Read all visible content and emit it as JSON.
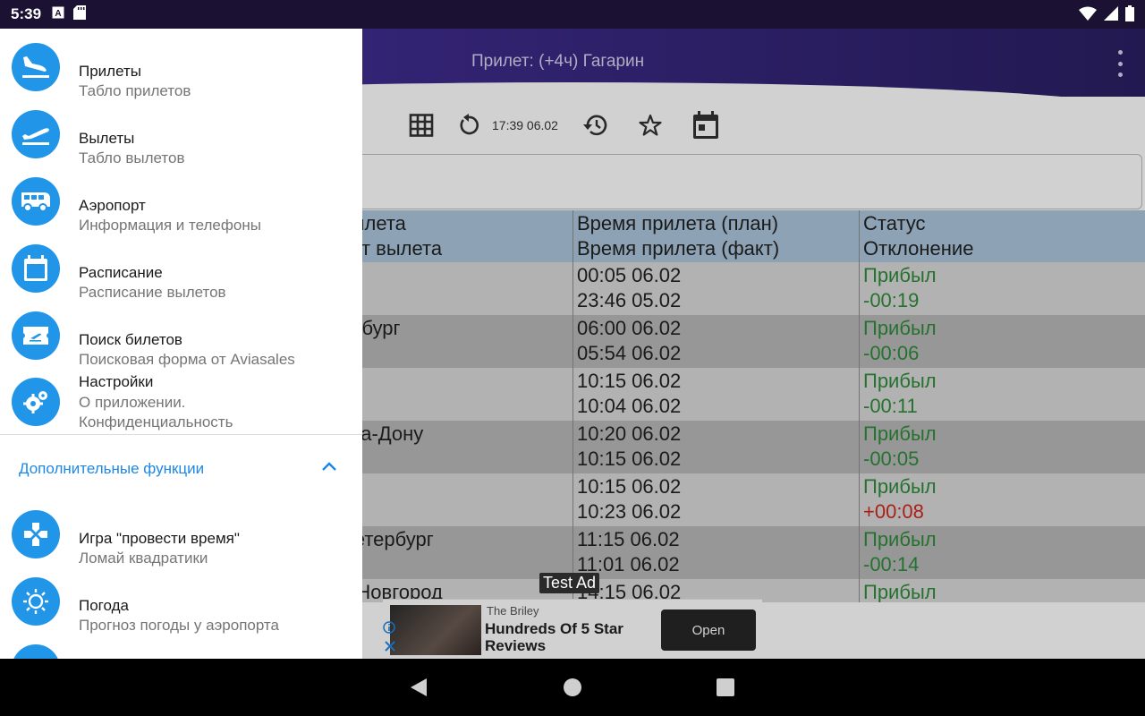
{
  "status_bar": {
    "time": "5:39",
    "icons": [
      "a-box-icon",
      "sd-card-icon",
      "wifi-icon",
      "signal-icon",
      "battery-icon"
    ]
  },
  "app_bar": {
    "title": "Прилет: (+4ч) Гагарин",
    "overflow_icon": "more-vert-icon"
  },
  "toolbar": {
    "update_time": "17:39 06.02",
    "icons": [
      "grid-icon",
      "refresh-icon",
      "history-icon",
      "star-icon",
      "calendar-icon"
    ]
  },
  "table": {
    "headers": {
      "col1_line1": "вылета",
      "col1_line2": "орт вылета",
      "col2_line1": "Время прилета (план)",
      "col2_line2": "Время прилета (факт)",
      "col3_line1": "Статус",
      "col3_line2": "Отклонение"
    },
    "rows": [
      {
        "city": "а",
        "planned": "00:05 06.02",
        "actual": "23:46 05.02",
        "status": "Прибыл",
        "deviation": "-00:19"
      },
      {
        "city": "инбург",
        "planned": "06:00 06.02",
        "actual": "05:54 06.02",
        "status": "Прибыл",
        "deviation": "-00:06"
      },
      {
        "city": "а",
        "planned": "10:15 06.02",
        "actual": "10:04 06.02",
        "status": "Прибыл",
        "deviation": "-00:11"
      },
      {
        "city": "-На-Дону",
        "planned": "10:20 06.02",
        "actual": "10:15 06.02",
        "status": "Прибыл",
        "deviation": "-00:05"
      },
      {
        "city": "а",
        "planned": "10:15 06.02",
        "actual": "10:23 06.02",
        "status": "Прибыл",
        "deviation": "+00:08"
      },
      {
        "city": "Петербург",
        "planned": "11:15 06.02",
        "actual": "11:01 06.02",
        "status": "Прибыл",
        "deviation": "-00:14"
      },
      {
        "city": "й Новгород",
        "planned": "14:15 06.02",
        "actual": "",
        "status": "Прибыл",
        "deviation": ""
      }
    ]
  },
  "ad": {
    "label": "Test Ad",
    "brand": "The Briley",
    "headline": "Hundreds Of 5 Star Reviews",
    "button": "Open"
  },
  "drawer": {
    "items": [
      {
        "title": "Прилеты",
        "subtitle": "Табло прилетов",
        "icon": "flight-land-icon"
      },
      {
        "title": "Вылеты",
        "subtitle": "Табло вылетов",
        "icon": "flight-takeoff-icon"
      },
      {
        "title": "Аэропорт",
        "subtitle": "Информация и телефоны",
        "icon": "bus-icon"
      },
      {
        "title": "Расписание",
        "subtitle": "Расписание вылетов",
        "icon": "calendar-icon"
      },
      {
        "title": "Поиск билетов",
        "subtitle": "Поисковая форма от Aviasales",
        "icon": "ticket-icon"
      },
      {
        "title": "Настройки",
        "subtitle_line1": "О приложении.",
        "subtitle_line2": "Конфиденциальность",
        "icon": "settings-icon"
      }
    ],
    "section_title": "Дополнительные функции",
    "extra_items": [
      {
        "title": "Игра \"провести время\"",
        "subtitle": "Ломай квадратики",
        "icon": "gamepad-icon"
      },
      {
        "title": "Погода",
        "subtitle": "Прогноз погоды у аэропорта",
        "icon": "weather-sun-icon"
      }
    ]
  },
  "colors": {
    "accent": "#2196e8",
    "status_ok": "#2e8b3a",
    "late": "#d0281f",
    "header_row": "#adc7dd"
  }
}
